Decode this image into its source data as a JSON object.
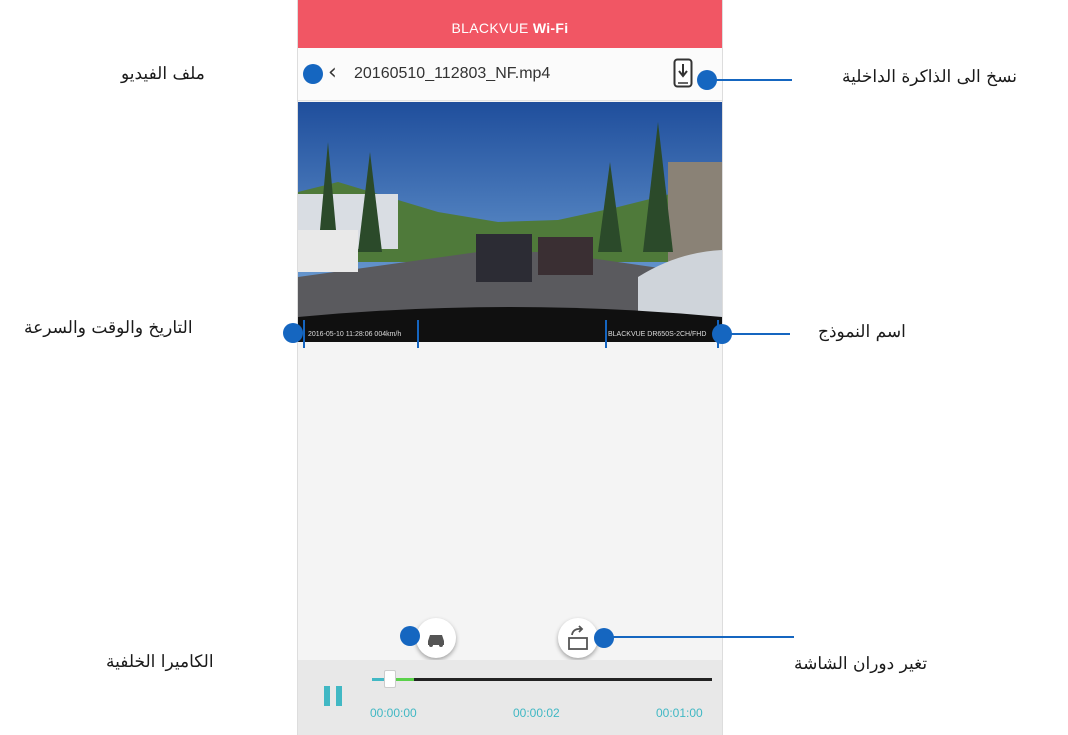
{
  "app": {
    "title_prefix": "BLACKVUE ",
    "title_bold": "Wi-Fi",
    "accent_color": "#f15664",
    "callout_color": "#1566c0",
    "playback_color": "#41b8c4"
  },
  "file_bar": {
    "back_icon": "chevron-left-icon",
    "filename": "20160510_112803_NF.mp4",
    "copy_icon": "phone-download-icon"
  },
  "video": {
    "osd_datetime_speed": "2016-05-10 11:28:06 004km/h",
    "osd_model": "BLACKVUE DR650S-2CH/FHD"
  },
  "buttons": {
    "rear_camera_icon": "car-icon",
    "rotate_icon": "rotate-screen-icon"
  },
  "player": {
    "pause_icon": "pause-icon",
    "progress_fraction": 0.04,
    "time_start": "00:00:00",
    "time_mid": "00:00:02",
    "time_end": "00:01:00"
  },
  "callouts": {
    "video_file": "ملف الفيديو",
    "copy_internal": "نسخ الى الذاكرة الداخلية",
    "datetime_speed": "التاريخ والوقت والسرعة",
    "model_name": "اسم النموذج",
    "rear_camera": "الكاميرا الخلفية",
    "rotate_screen": "تغير دوران الشاشة"
  }
}
